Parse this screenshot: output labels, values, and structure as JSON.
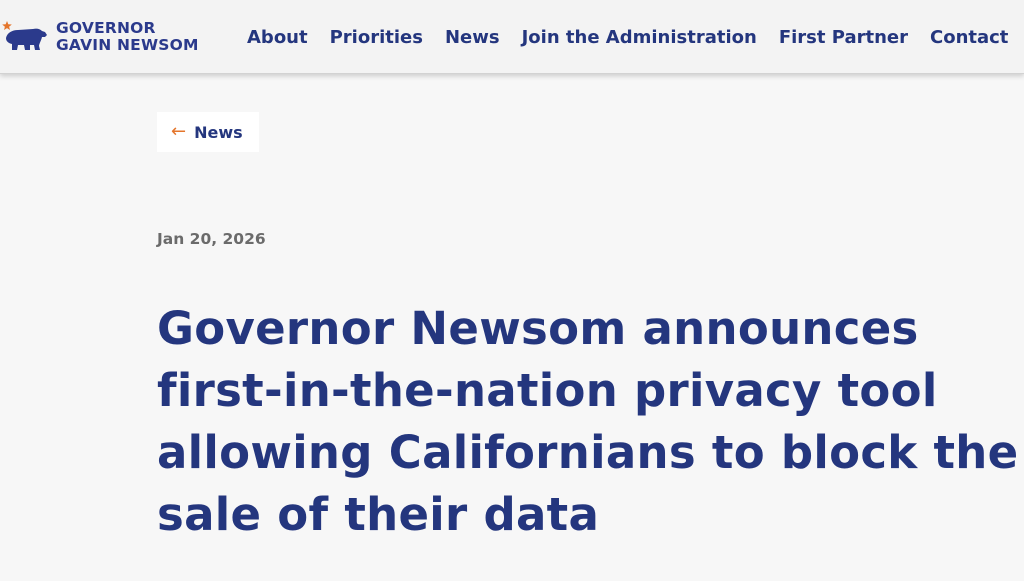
{
  "header": {
    "logo_line1": "GOVERNOR",
    "logo_line2": "GAVIN NEWSOM",
    "logo_icon": "california-bear-icon",
    "nav": [
      {
        "label": "About"
      },
      {
        "label": "Priorities"
      },
      {
        "label": "News"
      },
      {
        "label": "Join the Administration"
      },
      {
        "label": "First Partner"
      },
      {
        "label": "Contact"
      }
    ]
  },
  "back_link": {
    "icon": "arrow-left-icon",
    "label": "News"
  },
  "article": {
    "date": "Jan 20, 2026",
    "title": "Governor Newsom announces first-in-the-nation privacy tool allowing Californians to block the sale of their data"
  },
  "colors": {
    "brand_blue": "#24367e",
    "accent_orange": "#e4752b",
    "date_gray": "#6b6b6b",
    "page_bg": "#f7f7f7"
  }
}
